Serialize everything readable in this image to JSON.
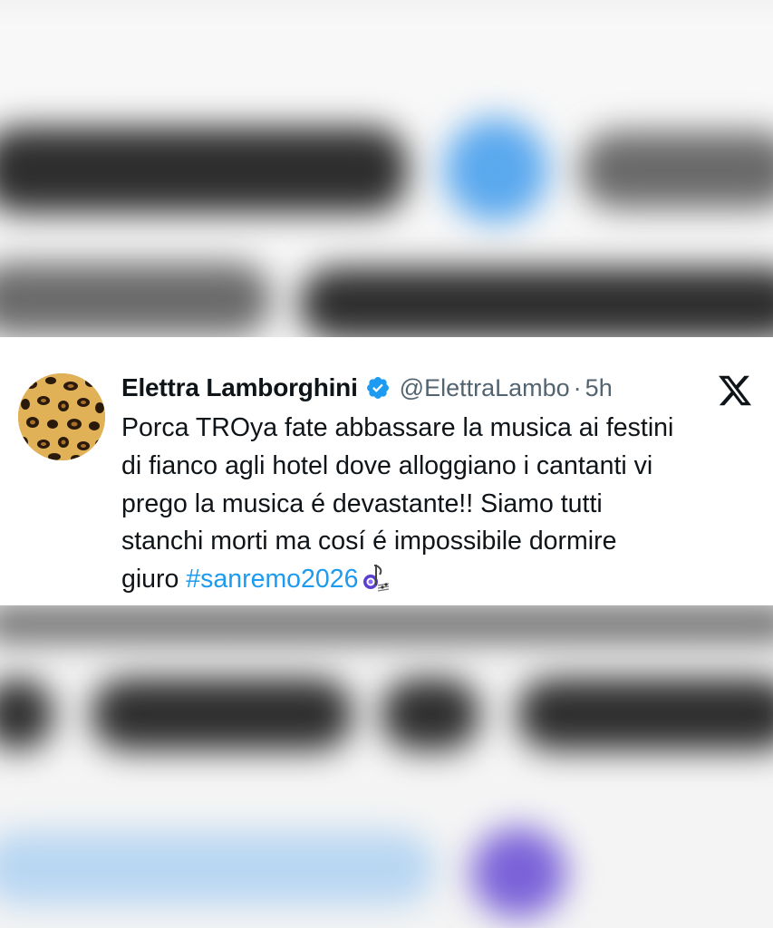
{
  "tweet": {
    "display_name": "Elettra Lamborghini",
    "handle": "@ElettraLambo",
    "separator": "·",
    "timestamp": "5h",
    "text_lines": [
      "Porca TROya fate abbassare la musica ai festini",
      "di fianco agli hotel dove alloggiano i cantanti vi",
      "prego la musica é devastante!! Siamo tutti",
      "stanchi morti ma cosí é impossibile dormire"
    ],
    "last_line_prefix": "giuro ",
    "hashtag": "#sanremo2026",
    "icons": {
      "avatar": "leopard-print-avatar",
      "verified": "verified-badge-icon",
      "platform": "x-logo-icon",
      "emoji": "musical-notes-emoji-icon"
    }
  },
  "colors": {
    "text": "#0f1419",
    "secondary_text": "#536471",
    "hashtag": "#1d9bf0",
    "verified": "#1d9bf0",
    "background": "#ffffff"
  }
}
